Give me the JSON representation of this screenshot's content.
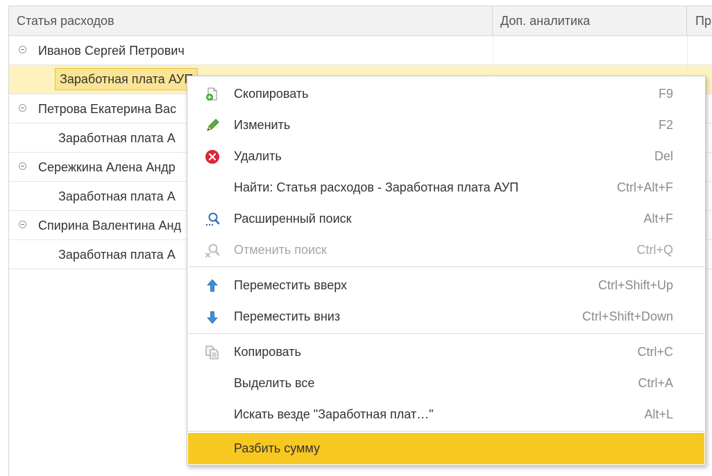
{
  "table": {
    "columns": [
      "Статья расходов",
      "Доп. аналитика",
      "Пр"
    ],
    "rows": [
      {
        "type": "group",
        "text": "Иванов Сергей Петрович"
      },
      {
        "type": "child",
        "text": "Заработная плата АУП",
        "selected": true
      },
      {
        "type": "group",
        "text": "Петрова Екатерина Вас"
      },
      {
        "type": "child",
        "text": "Заработная плата А"
      },
      {
        "type": "group",
        "text": "Сережкина Алена Андр"
      },
      {
        "type": "child",
        "text": "Заработная плата А"
      },
      {
        "type": "group",
        "text": "Спирина Валентина Анд"
      },
      {
        "type": "child",
        "text": "Заработная плата А"
      }
    ]
  },
  "menu": {
    "items": [
      {
        "label": "Скопировать",
        "shortcut": "F9",
        "icon": "copy-document-plus-icon"
      },
      {
        "label": "Изменить",
        "shortcut": "F2",
        "icon": "pencil-icon"
      },
      {
        "label": "Удалить",
        "shortcut": "Del",
        "icon": "delete-red-circle-icon"
      },
      {
        "label": "Найти: Статья расходов - Заработная плата АУП",
        "shortcut": "Ctrl+Alt+F",
        "icon": ""
      },
      {
        "label": "Расширенный поиск",
        "shortcut": "Alt+F",
        "icon": "advanced-search-icon"
      },
      {
        "label": "Отменить поиск",
        "shortcut": "Ctrl+Q",
        "icon": "cancel-search-icon",
        "disabled": true
      },
      {
        "separator": true
      },
      {
        "label": "Переместить вверх",
        "shortcut": "Ctrl+Shift+Up",
        "icon": "arrow-up-icon"
      },
      {
        "label": "Переместить вниз",
        "shortcut": "Ctrl+Shift+Down",
        "icon": "arrow-down-icon"
      },
      {
        "separator": true
      },
      {
        "label": "Копировать",
        "shortcut": "Ctrl+C",
        "icon": "clipboard-copy-icon"
      },
      {
        "label": "Выделить все",
        "shortcut": "Ctrl+A",
        "icon": ""
      },
      {
        "label": "Искать везде \"Заработная плат…\"",
        "shortcut": "Alt+L",
        "icon": ""
      },
      {
        "separator": true
      },
      {
        "label": "Разбить сумму",
        "shortcut": "",
        "icon": "",
        "highlighted": true
      }
    ]
  },
  "colors": {
    "selected_row": "#fdf2c0",
    "focused_cell": "#fbe594",
    "menu_highlight": "#f7c821",
    "disabled_text": "#a6a6a6"
  }
}
